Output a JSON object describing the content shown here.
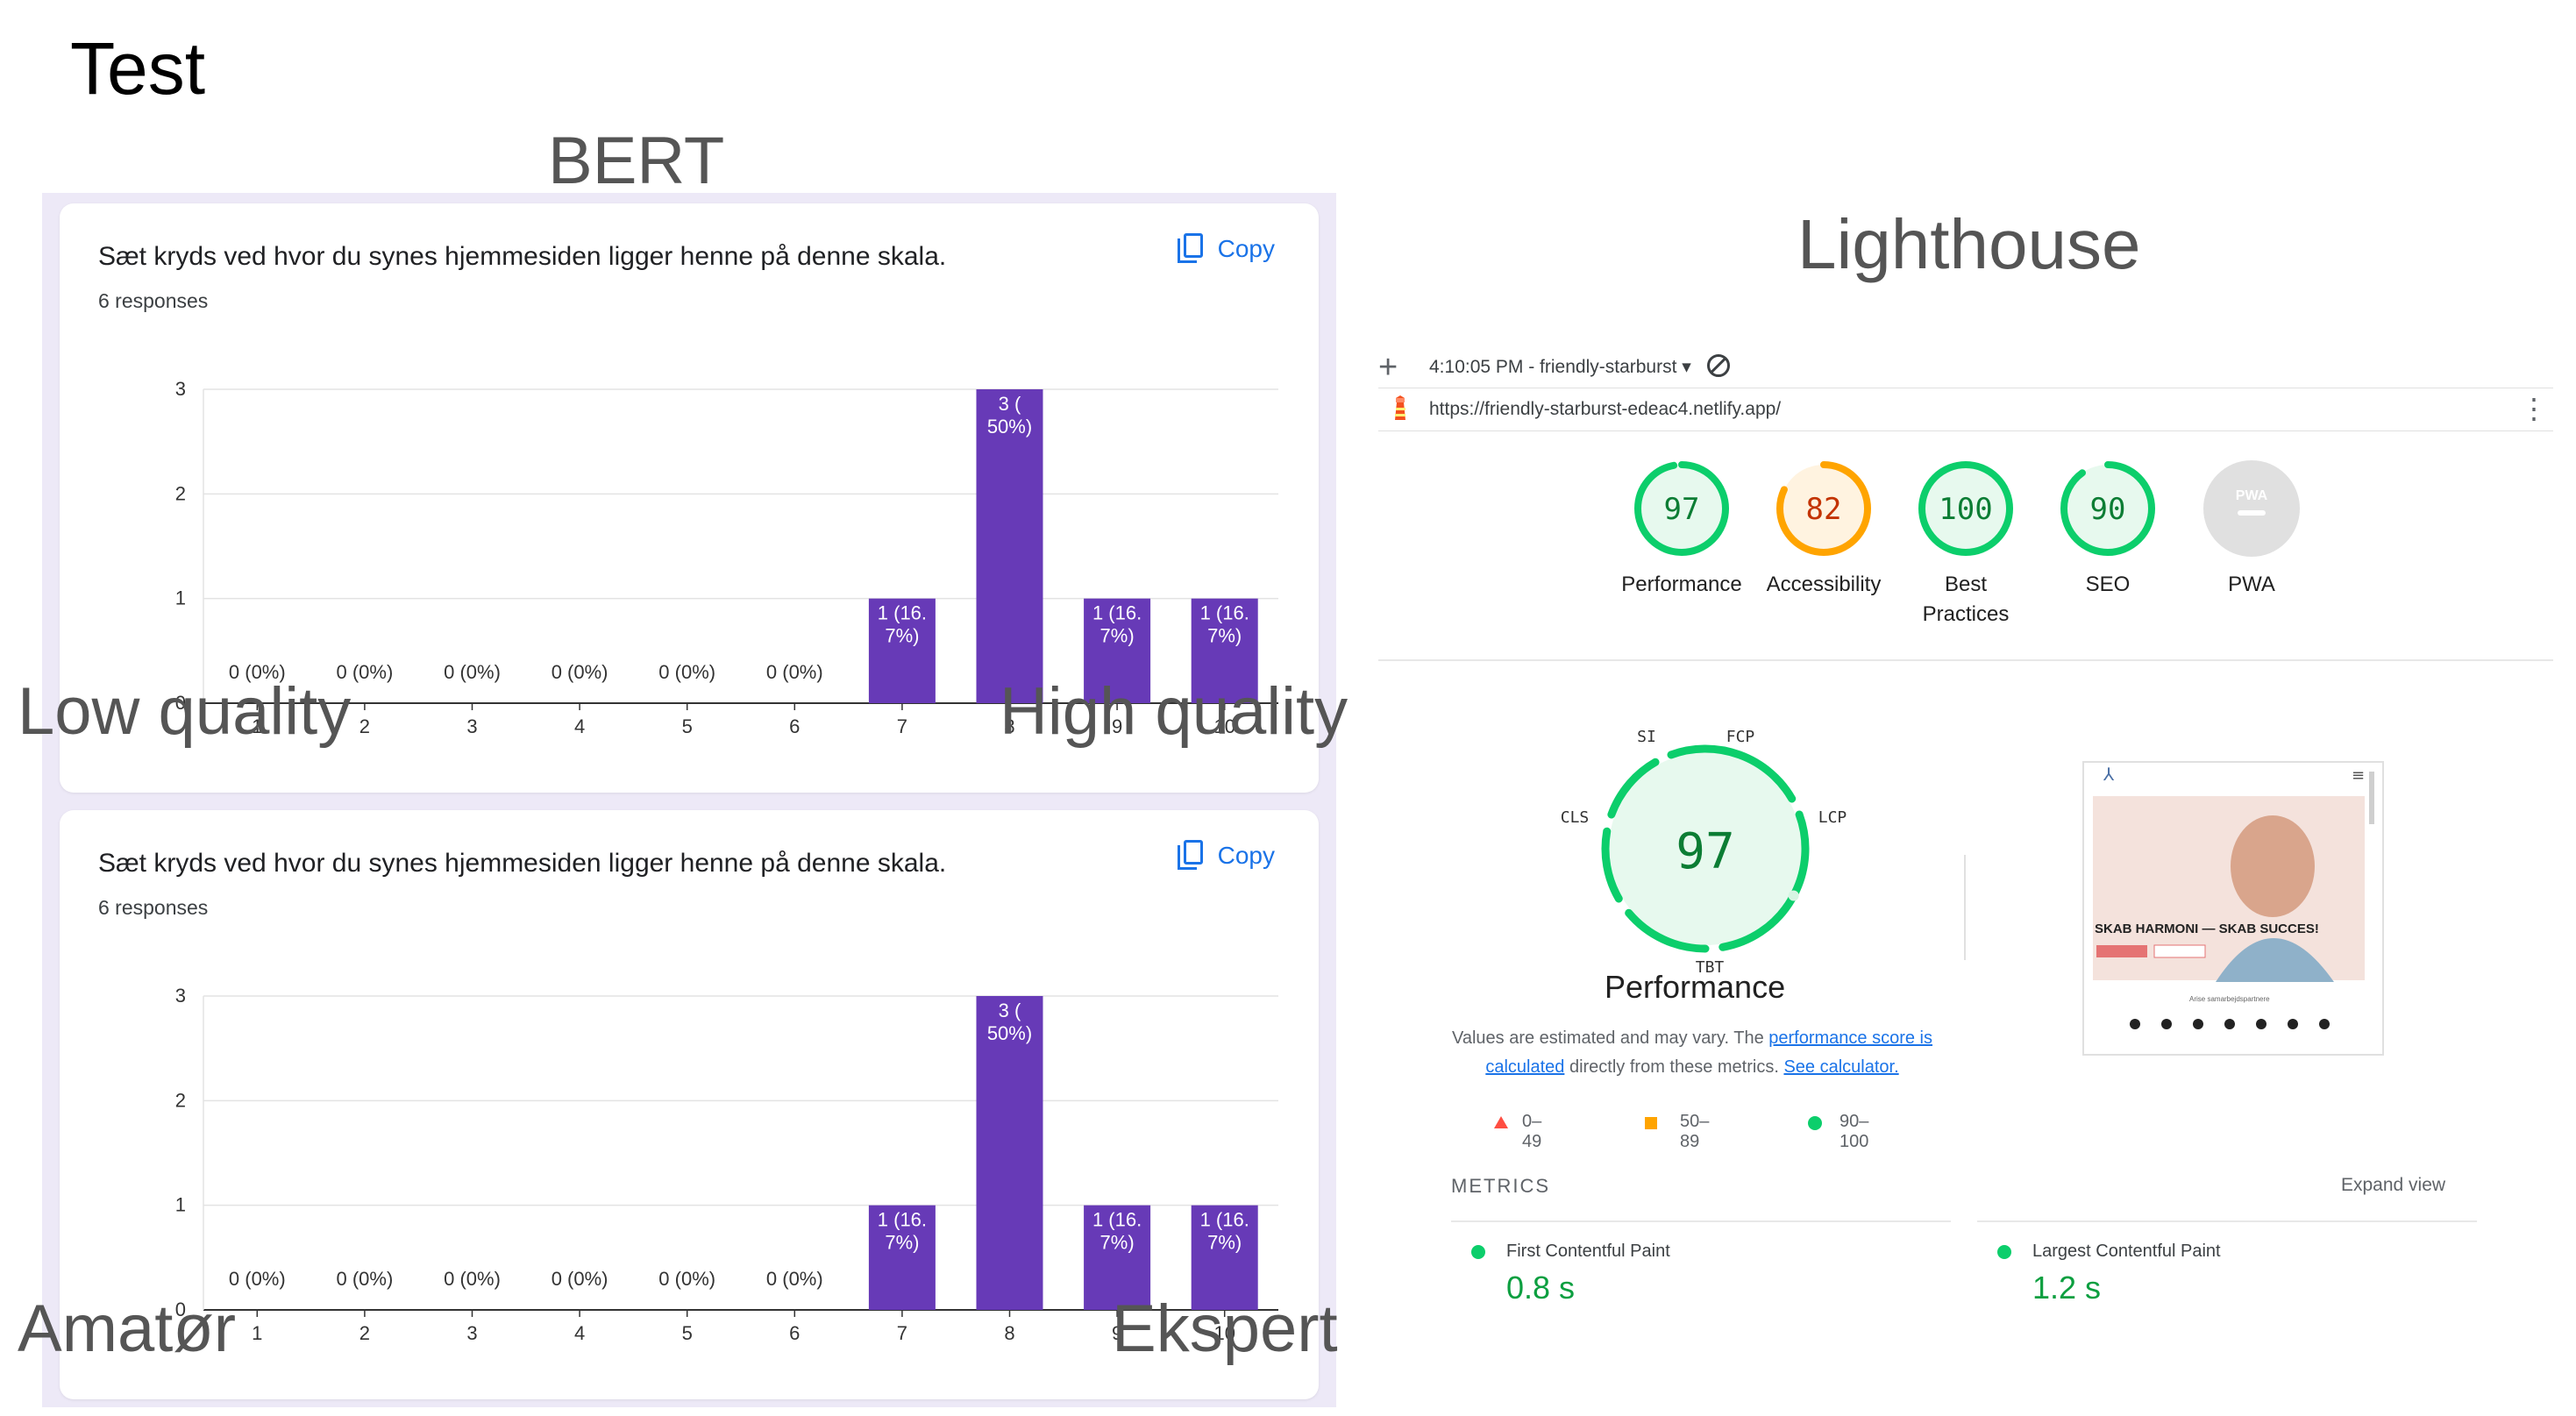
{
  "slide": {
    "title": "Test",
    "bert_title": "BERT",
    "lighthouse_title": "Lighthouse"
  },
  "forms": [
    {
      "question": "Sæt kryds ved hvor du synes hjemmesiden ligger henne på denne skala.",
      "responses": "6 responses",
      "copy_label": "Copy",
      "scale_low": "Low quality",
      "scale_high": "High quality"
    },
    {
      "question": "Sæt kryds ved hvor du synes hjemmesiden ligger henne på denne skala.",
      "responses": "6 responses",
      "copy_label": "Copy",
      "scale_low": "Amatør",
      "scale_high": "Ekspert"
    }
  ],
  "chart_data": [
    {
      "type": "bar",
      "categories": [
        "1",
        "2",
        "3",
        "4",
        "5",
        "6",
        "7",
        "8",
        "9",
        "10"
      ],
      "values": [
        0,
        0,
        0,
        0,
        0,
        0,
        1,
        3,
        1,
        1
      ],
      "data_labels": [
        [
          "0 (0%)"
        ],
        [
          "0 (0%)"
        ],
        [
          "0 (0%)"
        ],
        [
          "0 (0%)"
        ],
        [
          "0 (0%)"
        ],
        [
          "0 (0%)"
        ],
        [
          "1 (16.",
          "7%)"
        ],
        [
          "3 (",
          "50%)"
        ],
        [
          "1 (16.",
          "7%)"
        ],
        [
          "1 (16.",
          "7%)"
        ]
      ],
      "yticks": [
        "0",
        "1",
        "2",
        "3"
      ],
      "ylim": [
        0,
        3
      ],
      "grid": true,
      "bar_color": "#673ab7"
    },
    {
      "type": "bar",
      "categories": [
        "1",
        "2",
        "3",
        "4",
        "5",
        "6",
        "7",
        "8",
        "9",
        "10"
      ],
      "values": [
        0,
        0,
        0,
        0,
        0,
        0,
        1,
        3,
        1,
        1
      ],
      "data_labels": [
        [
          "0 (0%)"
        ],
        [
          "0 (0%)"
        ],
        [
          "0 (0%)"
        ],
        [
          "0 (0%)"
        ],
        [
          "0 (0%)"
        ],
        [
          "0 (0%)"
        ],
        [
          "1 (16.",
          "7%)"
        ],
        [
          "3 (",
          "50%)"
        ],
        [
          "1 (16.",
          "7%)"
        ],
        [
          "1 (16.",
          "7%)"
        ]
      ],
      "yticks": [
        "0",
        "1",
        "2",
        "3"
      ],
      "ylim": [
        0,
        3
      ],
      "grid": true,
      "bar_color": "#673ab7"
    }
  ],
  "lighthouse": {
    "plus": "+",
    "run": "4:10:05 PM - friendly-starburst ▾",
    "url": "https://friendly-starburst-edeac4.netlify.app/",
    "kebab": "⋮",
    "gauges": [
      {
        "score": "97",
        "label": "Performance",
        "value": 0.97,
        "color": "#0cce6b",
        "text_color": "#0c7d34",
        "bg": "#e7f9ee"
      },
      {
        "score": "82",
        "label": "Accessibility",
        "value": 0.82,
        "color": "#ffa400",
        "text_color": "#c33300",
        "bg": "#fff3e0"
      },
      {
        "score": "100",
        "label": "Best\nPractices",
        "value": 1.0,
        "color": "#0cce6b",
        "text_color": "#0c7d34",
        "bg": "#e7f9ee"
      },
      {
        "score": "90",
        "label": "SEO",
        "value": 0.9,
        "color": "#0cce6b",
        "text_color": "#0c7d34",
        "bg": "#e7f9ee"
      },
      {
        "score": "PWA",
        "label": "PWA",
        "value": 0,
        "color": "#cccccc",
        "text_color": "#ffffff",
        "bg": "#e0e0e0"
      }
    ],
    "big_gauge": {
      "score": "97",
      "title": "Performance",
      "labels": {
        "si": "SI",
        "fcp": "FCP",
        "lcp": "LCP",
        "tbt": "TBT",
        "cls": "CLS"
      }
    },
    "note_pre": "Values are estimated and may vary. The ",
    "note_link1": "performance score is calculated",
    "note_mid": " directly from these metrics. ",
    "note_link2": "See calculator.",
    "legend": [
      {
        "range": "0–49",
        "color": "#ff4e42",
        "shape": "triangle"
      },
      {
        "range": "50–89",
        "color": "#ffa400",
        "shape": "square"
      },
      {
        "range": "90–100",
        "color": "#0cce6b",
        "shape": "circle"
      }
    ],
    "metrics_header": "METRICS",
    "expand_label": "Expand view",
    "metrics": [
      {
        "name": "First Contentful Paint",
        "value": "0.8 s"
      },
      {
        "name": "Largest Contentful Paint",
        "value": "1.2 s"
      }
    ],
    "thumbnail": {
      "headline": "SKAB HARMONI — SKAB SUCCES!",
      "caption": "Arise samarbejdspartnere"
    }
  }
}
